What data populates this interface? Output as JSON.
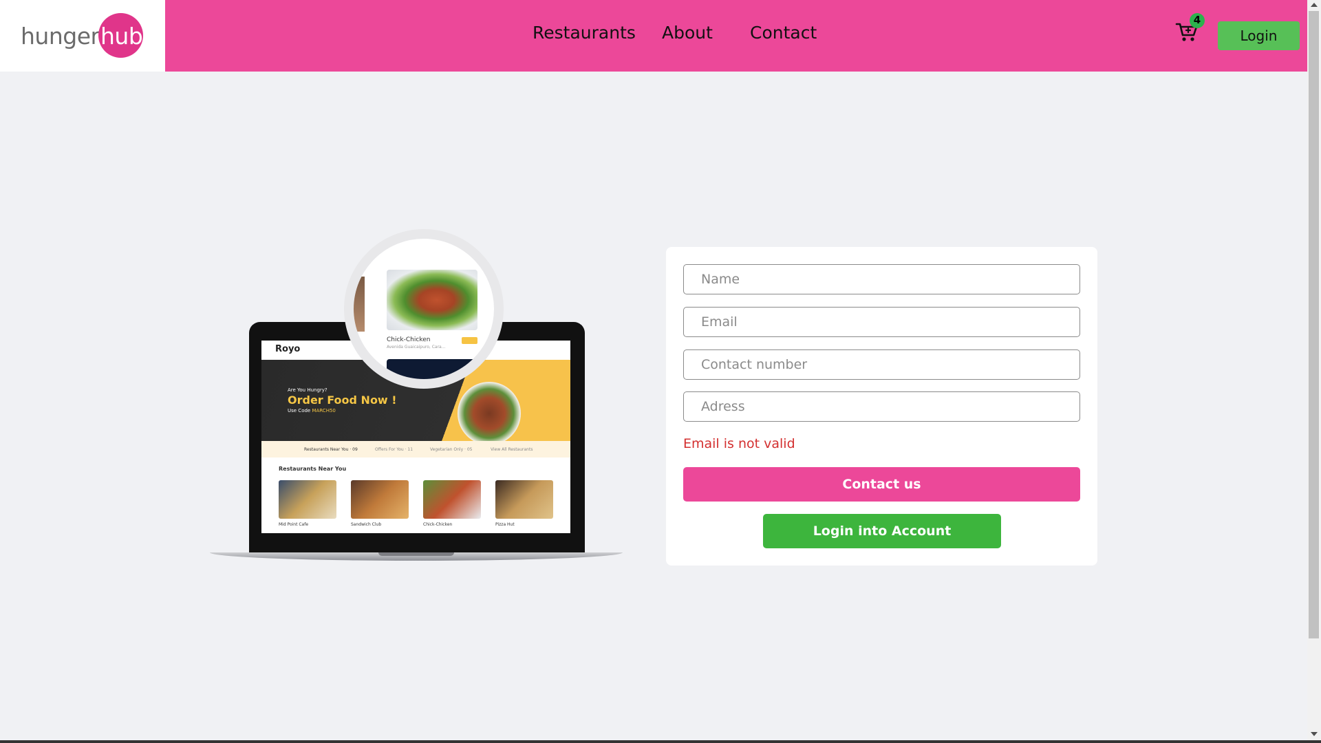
{
  "brand": {
    "part1": "hunger",
    "part2": "hub"
  },
  "nav": {
    "items": [
      {
        "label": "Restaurants"
      },
      {
        "label": "About"
      },
      {
        "label": "Contact"
      }
    ]
  },
  "cart": {
    "icon": "cart-plus-icon",
    "count": "4"
  },
  "header_login_label": "Login",
  "illustration": {
    "magnifier_title": "Chick-Chicken",
    "magnifier_subtitle": "Avenida Guaicaipuro, Cara...",
    "screen_brand": "Royo",
    "screen_hungry": "Are You Hungry?",
    "screen_headline": "Order Food Now !",
    "screen_code_prefix": "Use Code",
    "screen_code": "MARCH50",
    "screen_tabs": [
      "Restaurants Near You · 09",
      "Offers For You · 11",
      "Vegetarian Only · 05",
      "View All Restaurants"
    ],
    "screen_section": "Restaurants Near You",
    "screen_cards": [
      "Mid Point Cafe",
      "Sandwich Club",
      "Chick-Chicken",
      "Pizza Hut"
    ]
  },
  "form": {
    "name_placeholder": "Name",
    "email_placeholder": "Email",
    "contact_placeholder": "Contact number",
    "address_placeholder": "Adress",
    "error": "Email is not valid",
    "submit_label": "Contact us",
    "account_label": "Login into Account"
  },
  "colors": {
    "header": "#ec4899",
    "login_button": "#57c057",
    "submit_button": "#ec4899",
    "account_button": "#3db53d",
    "error_text": "#d32f2f",
    "page_background": "#f0f1f4"
  }
}
